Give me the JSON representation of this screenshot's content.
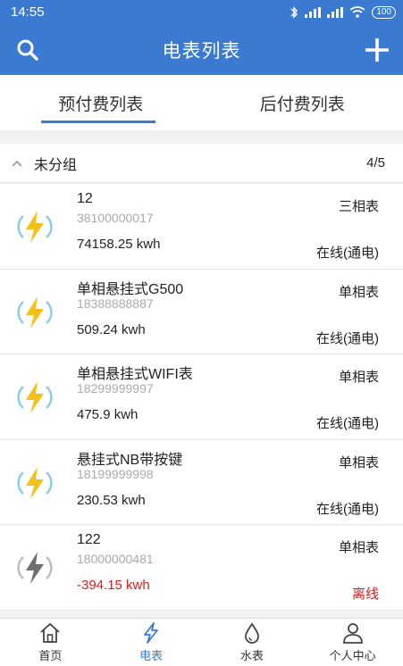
{
  "status_bar": {
    "time": "14:55",
    "battery": "100"
  },
  "header": {
    "title": "电表列表"
  },
  "tabs": [
    {
      "label": "预付费列表",
      "active": true
    },
    {
      "label": "后付费列表",
      "active": false
    }
  ],
  "group": {
    "name": "未分组",
    "count": "4/5"
  },
  "meters": [
    {
      "name": "12",
      "serial": "38100000017",
      "reading": "74158.25 kwh",
      "type": "三相表",
      "status": "在线(通电)",
      "online": true
    },
    {
      "name": "单相悬挂式G500",
      "serial": "18388888887",
      "reading": "509.24 kwh",
      "type": "单相表",
      "status": "在线(通电)",
      "online": true
    },
    {
      "name": "单相悬挂式WIFI表",
      "serial": "18299999997",
      "reading": "475.9 kwh",
      "type": "单相表",
      "status": "在线(通电)",
      "online": true
    },
    {
      "name": "悬挂式NB带按键",
      "serial": "18199999998",
      "reading": "230.53 kwh",
      "type": "单相表",
      "status": "在线(通电)",
      "online": true
    },
    {
      "name": "122",
      "serial": "18000000481",
      "reading": "-394.15 kwh",
      "type": "单相表",
      "status": "离线",
      "online": false
    }
  ],
  "bottom_nav": [
    {
      "label": "首页",
      "icon": "home-icon",
      "active": false
    },
    {
      "label": "电表",
      "icon": "lightning-icon",
      "active": true
    },
    {
      "label": "水表",
      "icon": "water-drop-icon",
      "active": false
    },
    {
      "label": "个人中心",
      "icon": "user-icon",
      "active": false
    }
  ],
  "colors": {
    "primary": "#3a7ad1",
    "danger": "#d42020",
    "bolt": "#f2c21b",
    "ring_online": "#8ecbea",
    "ring_offline": "#bdbdbd"
  }
}
